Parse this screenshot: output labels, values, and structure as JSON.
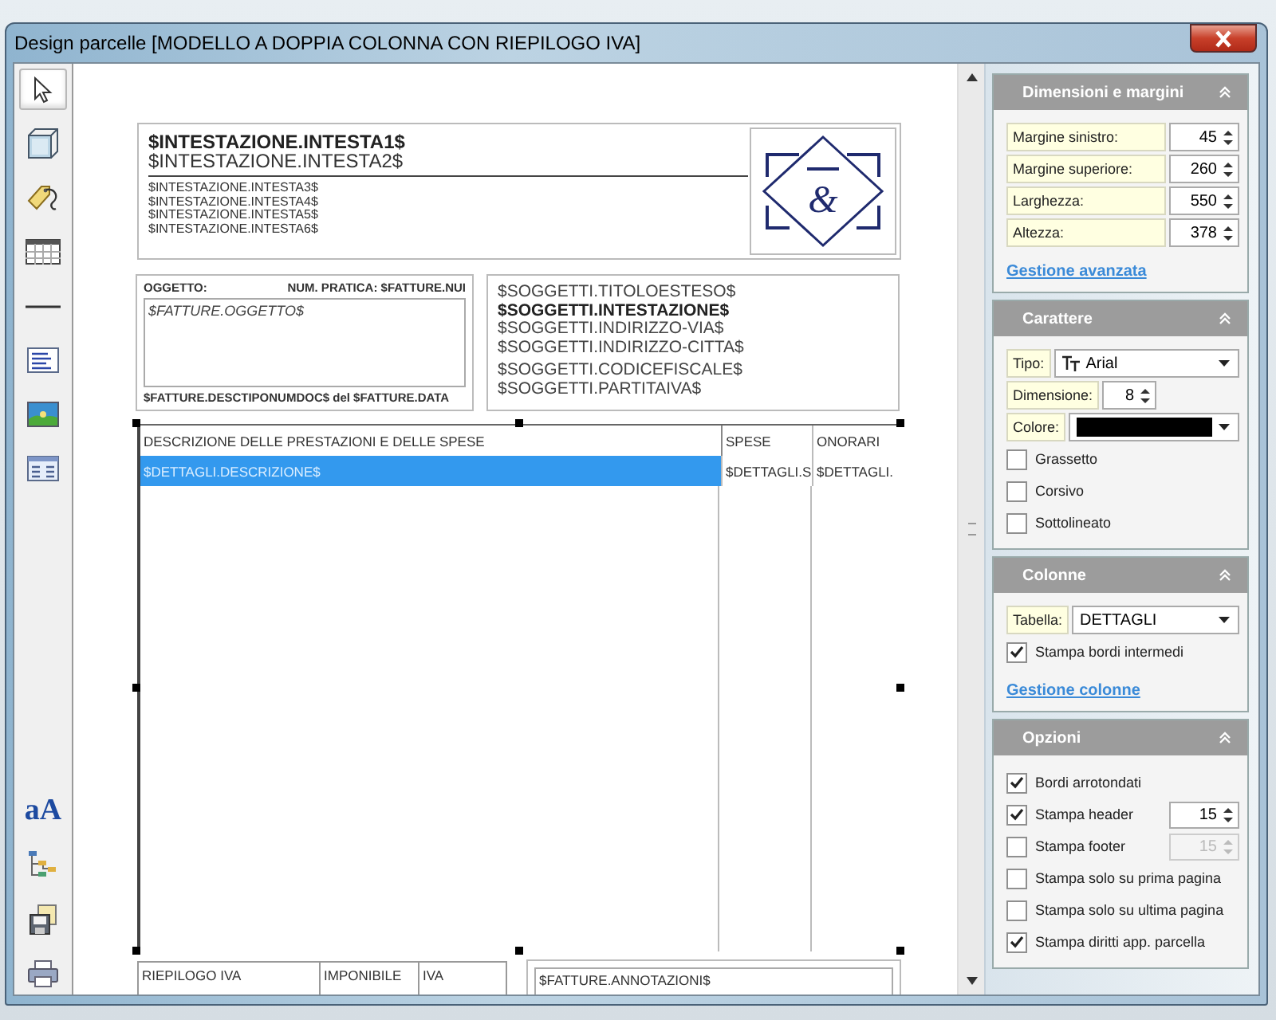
{
  "window": {
    "title": "Design parcelle [MODELLO A DOPPIA COLONNA CON RIEPILOGO IVA]"
  },
  "toolbar": {
    "tools": [
      {
        "kind": "pointer",
        "selected": true
      },
      {
        "kind": "box",
        "selected": false
      },
      {
        "kind": "tag",
        "selected": false
      },
      {
        "kind": "grid",
        "selected": false
      },
      {
        "kind": "line",
        "selected": false
      },
      {
        "kind": "text",
        "selected": false
      },
      {
        "kind": "image",
        "selected": false
      },
      {
        "kind": "form",
        "selected": false
      },
      {
        "kind": "spacer"
      },
      {
        "kind": "font",
        "glyph": "aA",
        "selected": false
      },
      {
        "kind": "tree",
        "selected": false
      },
      {
        "kind": "copy",
        "selected": false
      },
      {
        "kind": "print",
        "selected": false
      }
    ]
  },
  "canvas": {
    "header": {
      "lines": [
        {
          "text": "$INTESTAZIONE.INTESTA1$",
          "kind": "title"
        },
        {
          "text": "$INTESTAZIONE.INTESTA2$",
          "kind": "subtitle"
        },
        {
          "text": "$INTESTAZIONE.INTESTA3$",
          "kind": "small"
        },
        {
          "text": "$INTESTAZIONE.INTESTA4$",
          "kind": "small"
        },
        {
          "text": "$INTESTAZIONE.INTESTA5$",
          "kind": "small"
        },
        {
          "text": "$INTESTAZIONE.INTESTA6$",
          "kind": "small"
        }
      ],
      "logo_glyph": "&"
    },
    "oggetto": {
      "label": "OGGETTO:",
      "num_pratica": "NUM. PRATICA: $FATTURE.NUI",
      "field": "$FATTURE.OGGETTO$",
      "footer": "$FATTURE.DESCTIPONUMDOC$ del $FATTURE.DATA"
    },
    "soggetti": {
      "lines": [
        {
          "text": "$SOGGETTI.TITOLOESTESO$",
          "bold": false
        },
        {
          "text": "$SOGGETTI.INTESTAZIONE$",
          "bold": true
        },
        {
          "text": "$SOGGETTI.INDIRIZZO-VIA$",
          "bold": false
        },
        {
          "text": "$SOGGETTI.INDIRIZZO-CITTA$",
          "bold": false
        },
        {
          "text": "$SOGGETTI.CODICEFISCALE$",
          "bold": false
        },
        {
          "text": "$SOGGETTI.PARTITAIVA$",
          "bold": false
        }
      ]
    },
    "table": {
      "columns": [
        "DESCRIZIONE DELLE PRESTAZIONI E DELLE SPESE",
        "SPESE",
        "ONORARI"
      ],
      "rows": [
        {
          "cells": [
            "$DETTAGLI.DESCRIZIONE$",
            "$DETTAGLI.S",
            "$DETTAGLI."
          ],
          "selected": true
        }
      ]
    },
    "riepilogo": {
      "columns": [
        "RIEPILOGO IVA",
        "IMPONIBILE",
        "IVA"
      ]
    },
    "annotazioni": {
      "field": "$FATTURE.ANNOTAZIONI$"
    }
  },
  "panels": [
    {
      "title": "Dimensioni e margini",
      "expanded": true,
      "items": [
        {
          "kind": "spin",
          "label": "Margine sinistro:",
          "value": "45",
          "disabled": false
        },
        {
          "kind": "spin",
          "label": "Margine superiore:",
          "value": "260",
          "disabled": false
        },
        {
          "kind": "spin",
          "label": "Larghezza:",
          "value": "550",
          "disabled": false
        },
        {
          "kind": "spin",
          "label": "Altezza:",
          "value": "378",
          "disabled": false
        },
        {
          "kind": "link",
          "label": "Gestione avanzata"
        }
      ]
    },
    {
      "title": "Carattere",
      "expanded": true,
      "items": [
        {
          "kind": "select",
          "label": "Tipo:",
          "value": "Arial",
          "font_icon": true
        },
        {
          "kind": "spin",
          "label": "Dimensione:",
          "value": "8",
          "disabled": false,
          "narrow": true
        },
        {
          "kind": "color",
          "label": "Colore:",
          "color": "#000000"
        },
        {
          "kind": "checkbox",
          "label": "Grassetto",
          "checked": false
        },
        {
          "kind": "checkbox",
          "label": "Corsivo",
          "checked": false
        },
        {
          "kind": "checkbox",
          "label": "Sottolineato",
          "checked": false
        }
      ]
    },
    {
      "title": "Colonne",
      "expanded": true,
      "items": [
        {
          "kind": "select",
          "label": "Tabella:",
          "value": "DETTAGLI",
          "font_icon": false
        },
        {
          "kind": "checkbox",
          "label": "Stampa bordi intermedi",
          "checked": true
        },
        {
          "kind": "link",
          "label": "Gestione colonne"
        }
      ]
    },
    {
      "title": "Opzioni",
      "expanded": true,
      "items": [
        {
          "kind": "checkbox",
          "label": "Bordi arrotondati",
          "checked": true
        },
        {
          "kind": "checkspin",
          "label": "Stampa header",
          "checked": true,
          "value": "15",
          "disabled": false
        },
        {
          "kind": "checkspin",
          "label": "Stampa footer",
          "checked": false,
          "value": "15",
          "disabled": true
        },
        {
          "kind": "checkbox",
          "label": "Stampa solo su prima pagina",
          "checked": false
        },
        {
          "kind": "checkbox",
          "label": "Stampa solo su ultima pagina",
          "checked": false
        },
        {
          "kind": "checkbox",
          "label": "Stampa diritti app. parcella",
          "checked": true
        }
      ]
    }
  ]
}
